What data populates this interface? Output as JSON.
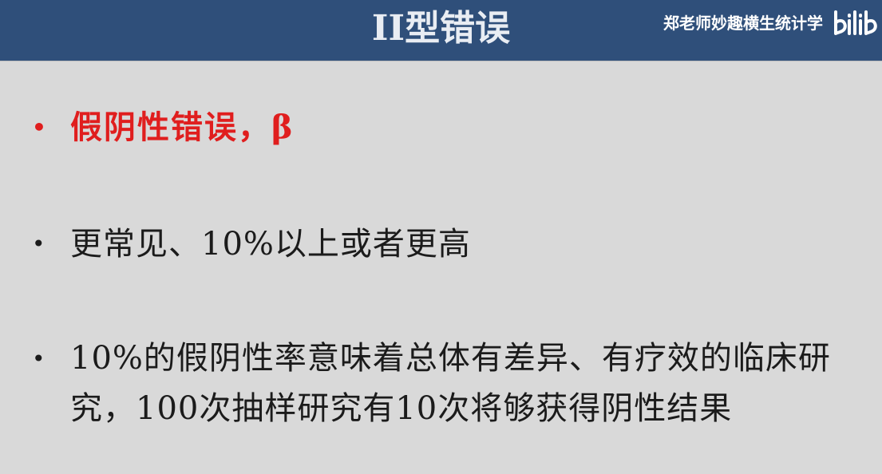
{
  "slide": {
    "title": "II型错误"
  },
  "watermark": {
    "text": "郑老师妙趣横生统计学",
    "logo_icon": "bilibili-logo-icon",
    "logo_text": "bilib"
  },
  "bullets": [
    {
      "marker": "•",
      "text": "假阴性错误，β",
      "color": "#e01e1e"
    },
    {
      "marker": "•",
      "text": "更常见、10%以上或者更高",
      "color": "#1b1b1b"
    },
    {
      "marker": "•",
      "text": "10%的假阴性率意味着总体有差异、有疗效的临床研究，100次抽样研究有10次将够获得阴性结果",
      "color": "#1b1b1b"
    }
  ],
  "colors": {
    "header_bg": "#2f4f7a",
    "slide_bg": "#d9d9d9",
    "highlight": "#e01e1e"
  }
}
